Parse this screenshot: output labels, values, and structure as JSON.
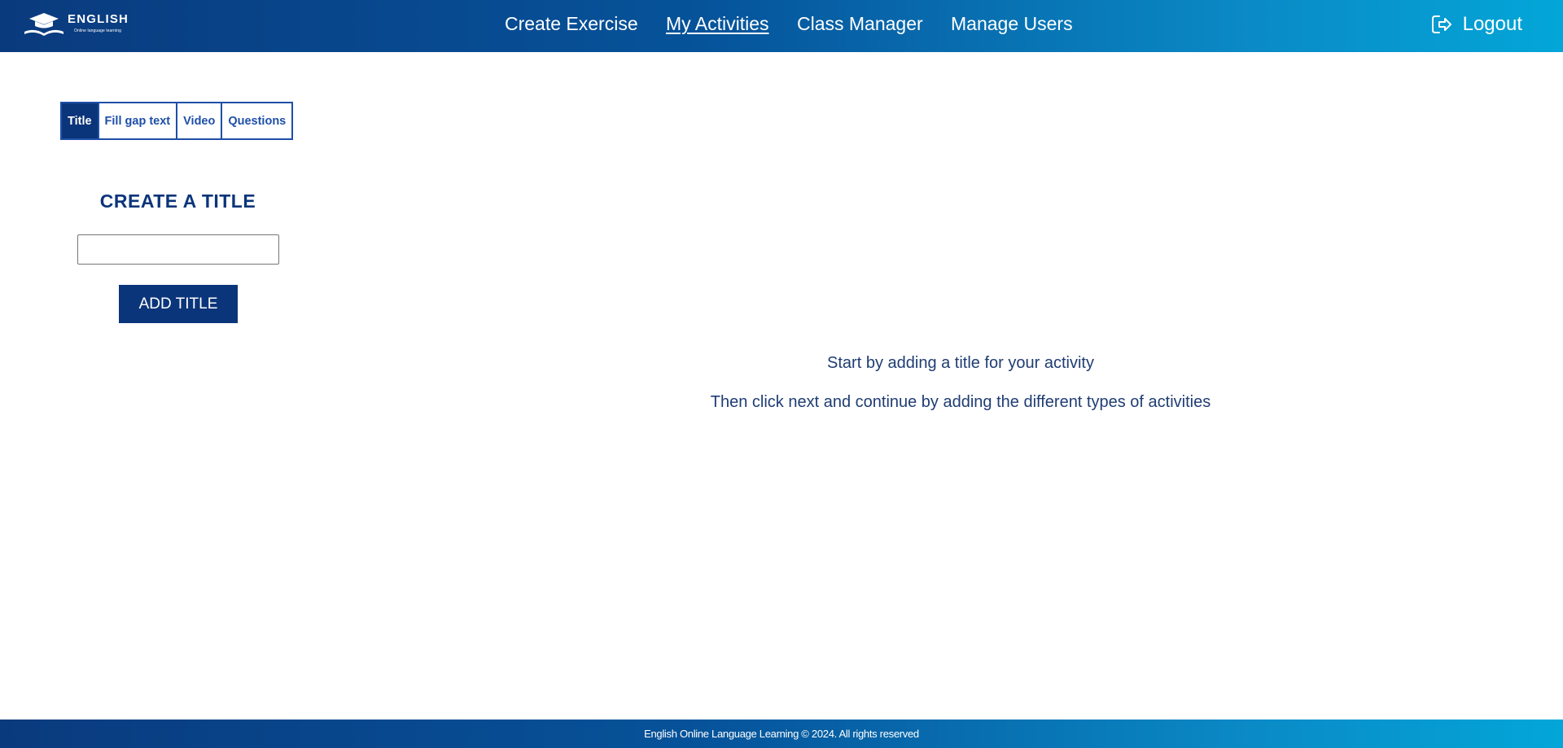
{
  "brand": {
    "title": "ENGLISH",
    "subtitle": "Online language learning"
  },
  "nav": {
    "items": [
      {
        "label": "Create Exercise"
      },
      {
        "label": "My Activities",
        "active": true
      },
      {
        "label": "Class Manager"
      },
      {
        "label": "Manage Users"
      }
    ],
    "logout_label": "Logout"
  },
  "tabs": [
    {
      "label": "Title",
      "active": true
    },
    {
      "label": "Fill gap text"
    },
    {
      "label": "Video"
    },
    {
      "label": "Questions"
    }
  ],
  "form": {
    "heading": "CREATE A TITLE",
    "input_value": "",
    "button_label": "ADD TITLE"
  },
  "help": {
    "line1": "Start by adding a title for your activity",
    "line2": "Then click next and continue by adding the different types of activities"
  },
  "footer": {
    "text": "English Online Language Learning © 2024. All rights reserved"
  },
  "colors": {
    "primary": "#0b357a",
    "accent": "#1e4fa8",
    "header_gradient_end": "#03a6d8"
  }
}
